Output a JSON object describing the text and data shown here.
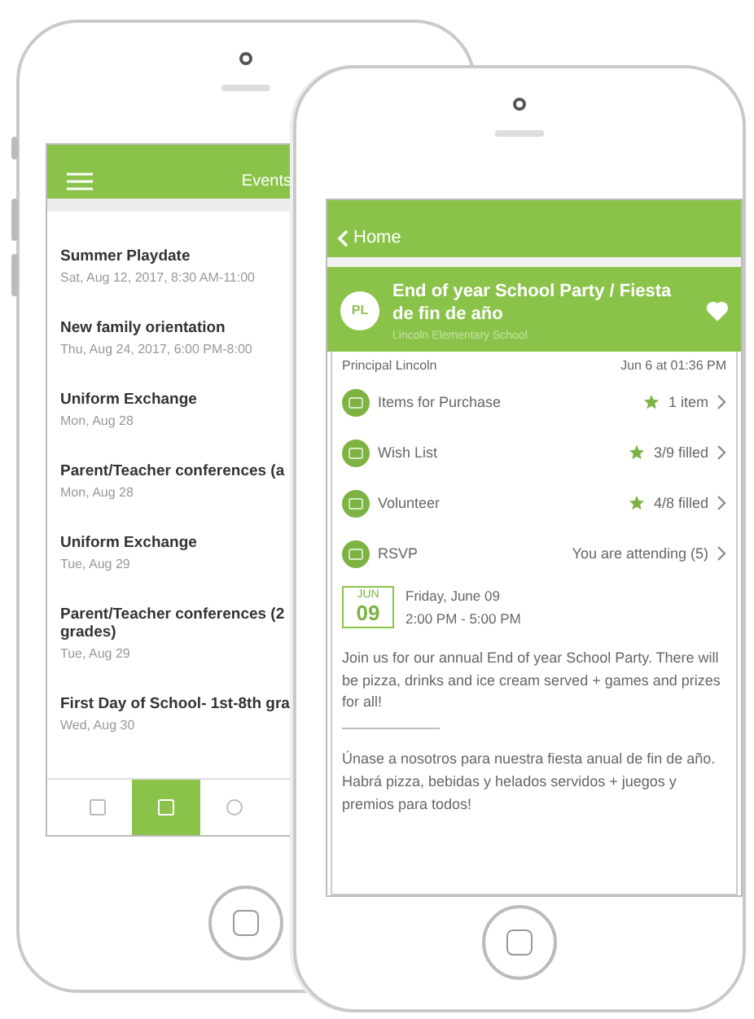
{
  "back_phone": {
    "title": "Events",
    "events": [
      {
        "title": "Summer Playdate",
        "date": "Sat, Aug 12, 2017, 8:30 AM-11:00"
      },
      {
        "title": "New family orientation",
        "date": "Thu, Aug 24, 2017, 6:00 PM-8:00"
      },
      {
        "title": "Uniform Exchange",
        "date": "Mon, Aug 28"
      },
      {
        "title": "Parent/Teacher conferences (a",
        "date": "Mon, Aug 28"
      },
      {
        "title": "Uniform Exchange",
        "date": "Tue, Aug 29"
      },
      {
        "title": "Parent/Teacher conferences (2\ngrades)",
        "date": "Tue, Aug 29"
      },
      {
        "title": "First Day of School- 1st-8th gra",
        "date": "Wed, Aug 30"
      }
    ],
    "tabs": [
      {
        "selected": false
      },
      {
        "selected": true
      },
      {
        "selected": false
      }
    ]
  },
  "front_phone": {
    "back_label": "Home",
    "event": {
      "avatar": "PL",
      "title": "End of year School Party / Fiesta de fin de año",
      "subtitle": "Lincoln Elementary School",
      "favorite": true
    },
    "author": "Principal Lincoln",
    "posted": "Jun 6 at 01:36 PM",
    "rows": [
      {
        "label": "Items for Purchase",
        "value": "1 item",
        "starred": true
      },
      {
        "label": "Wish List",
        "value": "3/9 filled",
        "starred": true
      },
      {
        "label": "Volunteer",
        "value": "4/8 filled",
        "starred": true
      },
      {
        "label": "RSVP",
        "value": "You are attending (5)",
        "starred": false
      }
    ],
    "date": {
      "month": "JUN",
      "day": "09",
      "weekday_date": "Friday, June 09",
      "time": "2:00 PM - 5:00 PM"
    },
    "description": "Join us for our annual End of year School Party. There will be pizza, drinks and ice cream served + games and prizes for all!",
    "description_es": "Únase a nosotros para nuestra fiesta anual de fin de año. Habrá pizza, bebidas y helados servidos + juegos y premios para todos!"
  }
}
